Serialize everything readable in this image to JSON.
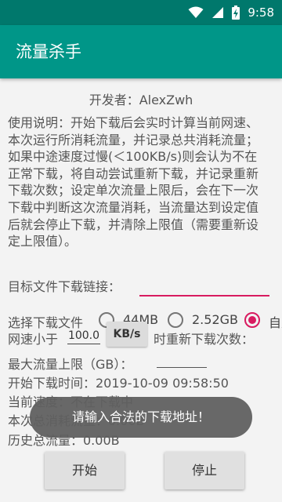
{
  "status_bar": {
    "time": "9:58"
  },
  "app": {
    "title": "流量杀手"
  },
  "developer": "开发者：AlexZwh",
  "instructions": "使用说明：开始下载后会实时计算当前网速、本次运行所消耗流量，并记录总共消耗流量；如果中途速度过慢(＜100KB/s)则会认为不在正常下载，将自动尝试重新下载，并记录重新下载次数；设定单次流量上限后，会在下一次下载中判断这次流量消耗，当流量达到设定值后就会停止下载，并清除上限值（需要重新设定上限值）。",
  "download_url": {
    "label": "目标文件下载链接：",
    "value": ""
  },
  "file_choice": {
    "label": "选择下载文件",
    "options": [
      {
        "label": "44MB",
        "checked": false
      },
      {
        "label": "2.52GB",
        "checked": false
      },
      {
        "label": "自定",
        "checked": true
      }
    ]
  },
  "speed_threshold": {
    "label": "网速小于",
    "value": "100.0",
    "unit": "KB/s",
    "suffix": "时重新下载次数："
  },
  "max_traffic": {
    "label": "最大流量上限（GB）：",
    "value": ""
  },
  "start_time": "开始下载时间：2019-10-09 09:58:50",
  "current_speed": "当前速度：不在下载中",
  "session_traffic": "本次总消耗流量：0.00B",
  "history_traffic": "历史总流量：0.00B",
  "toast": "请输入合法的下载地址！",
  "buttons": {
    "start": "开始",
    "stop": "停止"
  }
}
